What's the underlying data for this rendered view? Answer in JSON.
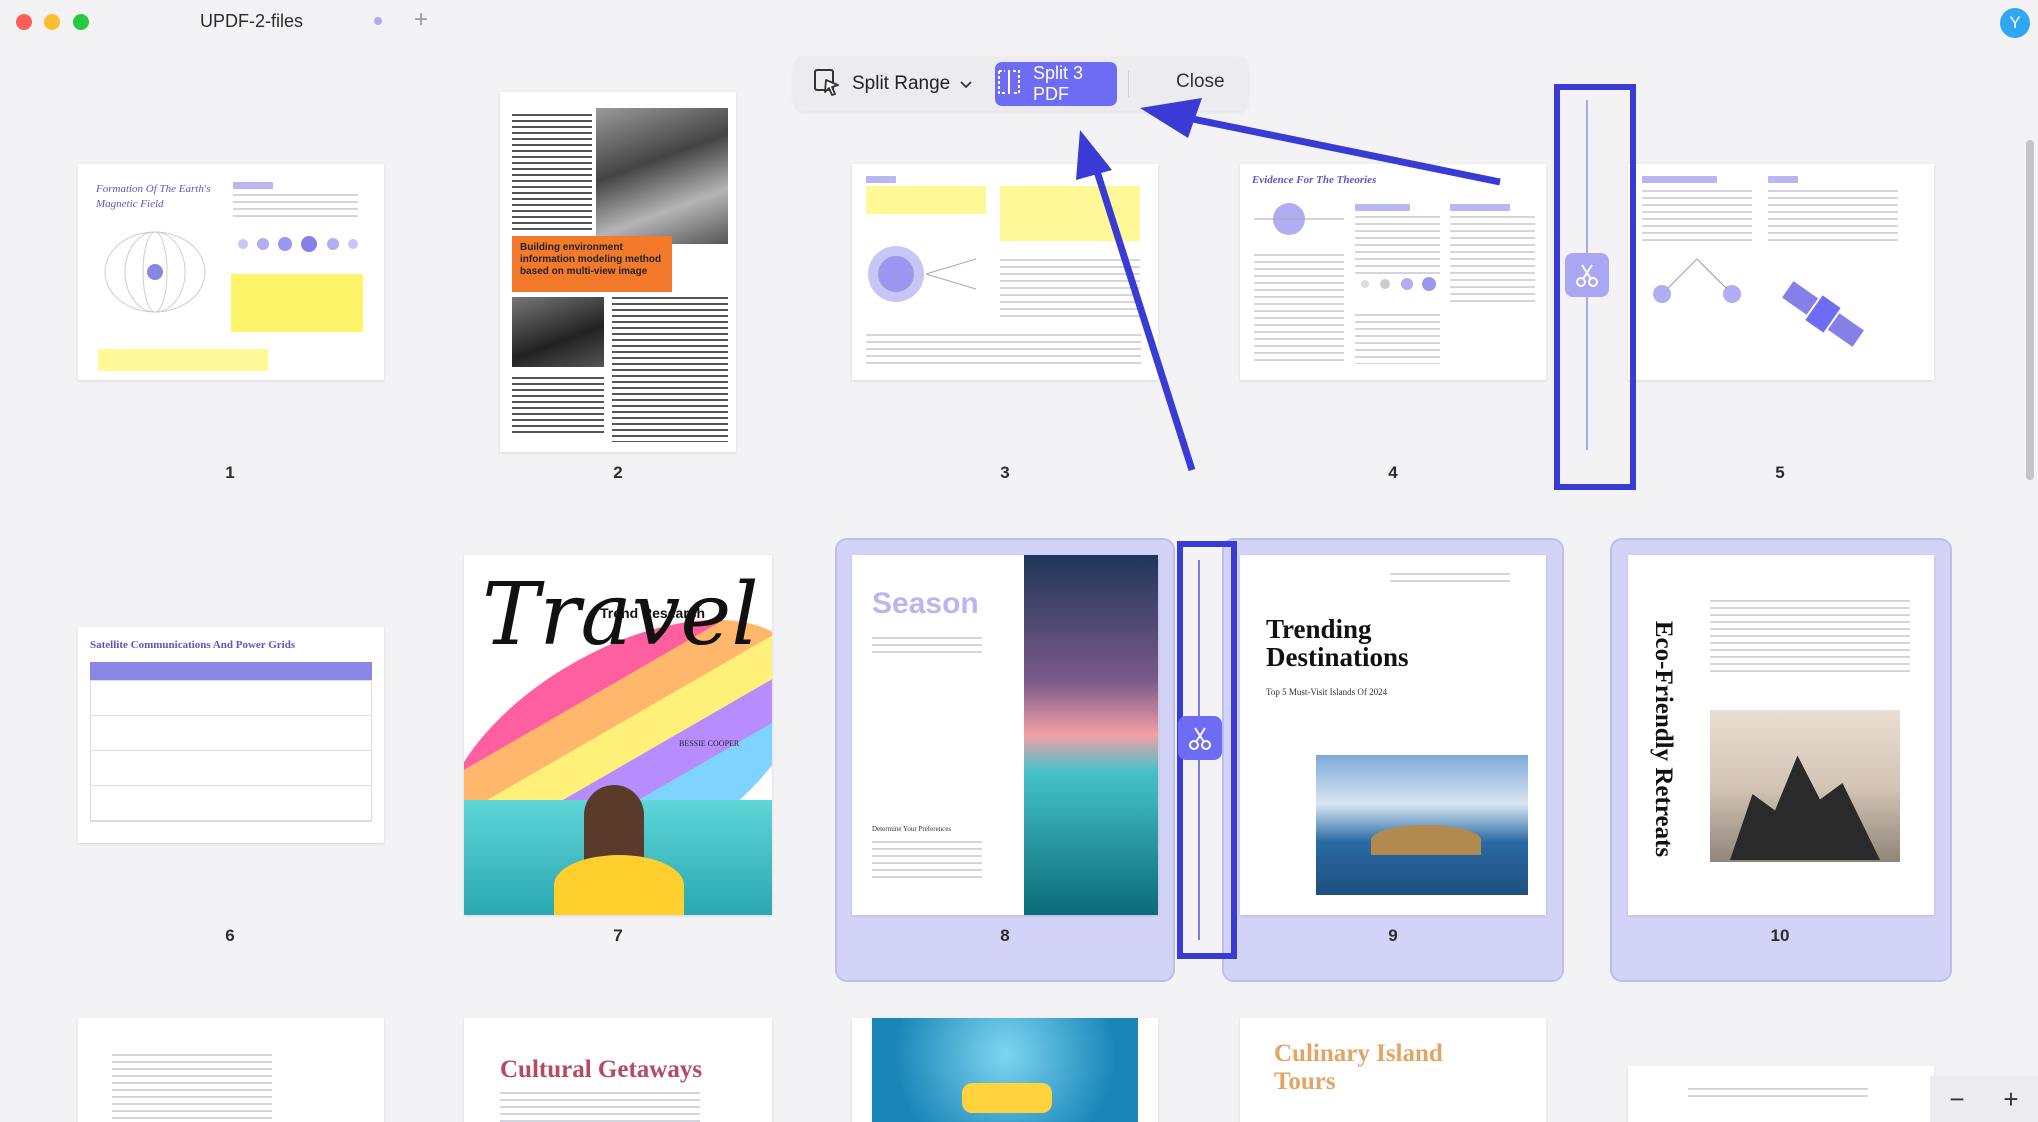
{
  "window": {
    "tab_title": "UPDF-2-files",
    "tab_add": "+",
    "avatar_initial": "Y"
  },
  "toolbar": {
    "split_range_label": "Split Range",
    "split_button_label": "Split 3 PDF",
    "close_label": "Close"
  },
  "colors": {
    "accent": "#6e6cf5",
    "annotation": "#3a3ad4",
    "group_fill": "#d3d3f7"
  },
  "pages": [
    {
      "number": "1",
      "title": "Formation Of The Earth's Magnetic Field"
    },
    {
      "number": "2",
      "title": "Building environment information modeling method based on multi-view image"
    },
    {
      "number": "3",
      "title": ""
    },
    {
      "number": "4",
      "title": "Evidence For The Theories"
    },
    {
      "number": "5",
      "title": ""
    },
    {
      "number": "6",
      "title": "Satellite Communications And Power Grids"
    },
    {
      "number": "7",
      "title": "Travel",
      "subtitle": "Trend Research",
      "author": "BESSIE COOPER"
    },
    {
      "number": "8",
      "title": "Season",
      "subhead": "Determine Your Preferences"
    },
    {
      "number": "9",
      "title": "Trending Destinations",
      "subtitle": "Top 5 Must-Visit Islands Of 2024"
    },
    {
      "number": "10",
      "title": "Eco-Friendly Retreats"
    },
    {
      "number": "",
      "title": ""
    },
    {
      "number": "",
      "title": "Cultural Getaways"
    },
    {
      "number": "",
      "title": ""
    },
    {
      "number": "",
      "title": "Culinary Island Tours"
    },
    {
      "number": "",
      "title": ""
    }
  ],
  "icons": {
    "split_range": "cursor-select-icon",
    "split": "split-doc-icon",
    "scissors": "scissors-icon"
  },
  "zoom": {
    "minus": "−",
    "plus": "+"
  }
}
